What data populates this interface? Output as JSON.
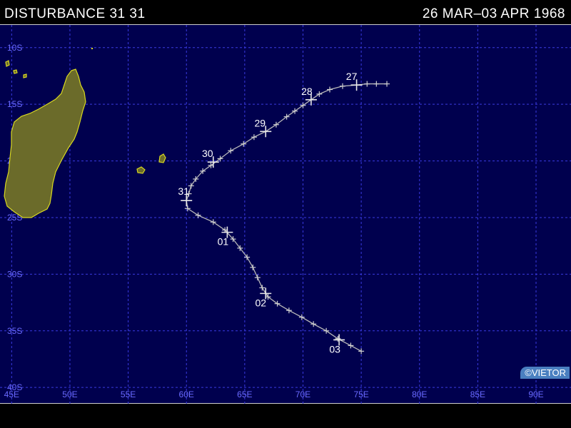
{
  "header": {
    "title": "DISTURBANCE 31 31",
    "date_range": "26 MAR–03 APR 1968"
  },
  "map": {
    "lon_range": [
      44,
      93
    ],
    "lat_range": [
      -41.5,
      -8
    ],
    "grid_lons": [
      45,
      50,
      55,
      60,
      65,
      70,
      75,
      80,
      85,
      90
    ],
    "grid_lats": [
      -10,
      -15,
      -20,
      -25,
      -30,
      -35,
      -40
    ],
    "lon_labels": [
      "45E",
      "50E",
      "55E",
      "60E",
      "65E",
      "70E",
      "75E",
      "80E",
      "85E",
      "90E"
    ],
    "lat_labels": [
      "10S",
      "15S",
      "20S",
      "25S",
      "30S",
      "35S",
      "40S"
    ],
    "colors": {
      "ocean": "#00004e",
      "grid": "#3a3ae0",
      "label": "#6a6aff",
      "land": "#6b6b2a",
      "coast": "#d8d820",
      "track": "#b8b8b8"
    }
  },
  "track": {
    "points": [
      [
        77.2,
        -13.2
      ],
      [
        76.3,
        -13.2
      ],
      [
        75.5,
        -13.2
      ],
      [
        74.6,
        -13.3
      ],
      [
        73.4,
        -13.4
      ],
      [
        72.3,
        -13.7
      ],
      [
        71.4,
        -14.1
      ],
      [
        70.7,
        -14.6
      ],
      [
        70.0,
        -15.1
      ],
      [
        69.3,
        -15.6
      ],
      [
        68.6,
        -16.1
      ],
      [
        67.7,
        -16.8
      ],
      [
        66.8,
        -17.4
      ],
      [
        65.8,
        -17.9
      ],
      [
        64.9,
        -18.5
      ],
      [
        63.8,
        -19.1
      ],
      [
        62.9,
        -19.8
      ],
      [
        62.1,
        -20.4
      ],
      [
        61.4,
        -20.9
      ],
      [
        60.8,
        -21.6
      ],
      [
        60.4,
        -22.2
      ],
      [
        60.2,
        -22.9
      ],
      [
        60.0,
        -23.5
      ],
      [
        60.1,
        -24.2
      ],
      [
        61.0,
        -24.8
      ],
      [
        62.3,
        -25.4
      ],
      [
        63.3,
        -26.1
      ],
      [
        64.0,
        -26.9
      ],
      [
        64.6,
        -27.7
      ],
      [
        65.2,
        -28.5
      ],
      [
        65.7,
        -29.4
      ],
      [
        66.1,
        -30.3
      ],
      [
        66.5,
        -31.2
      ],
      [
        67.0,
        -32.0
      ],
      [
        67.8,
        -32.6
      ],
      [
        68.8,
        -33.2
      ],
      [
        69.9,
        -33.8
      ],
      [
        70.9,
        -34.4
      ],
      [
        72.0,
        -35.0
      ],
      [
        73.0,
        -35.7
      ],
      [
        74.1,
        -36.3
      ],
      [
        75.0,
        -36.8
      ]
    ],
    "major_fixes": [
      {
        "label": "27",
        "lon": 74.6,
        "lat": -13.3
      },
      {
        "label": "28",
        "lon": 70.7,
        "lat": -14.6
      },
      {
        "label": "29",
        "lon": 66.8,
        "lat": -17.4
      },
      {
        "label": "30",
        "lon": 62.3,
        "lat": -20.1
      },
      {
        "label": "31",
        "lon": 60.0,
        "lat": -23.5
      },
      {
        "label": "01",
        "lon": 63.5,
        "lat": -26.3
      },
      {
        "label": "02",
        "lon": 66.8,
        "lat": -31.7
      },
      {
        "label": "03",
        "lon": 73.1,
        "lat": -35.8
      }
    ]
  },
  "credit": "©VIETOR"
}
